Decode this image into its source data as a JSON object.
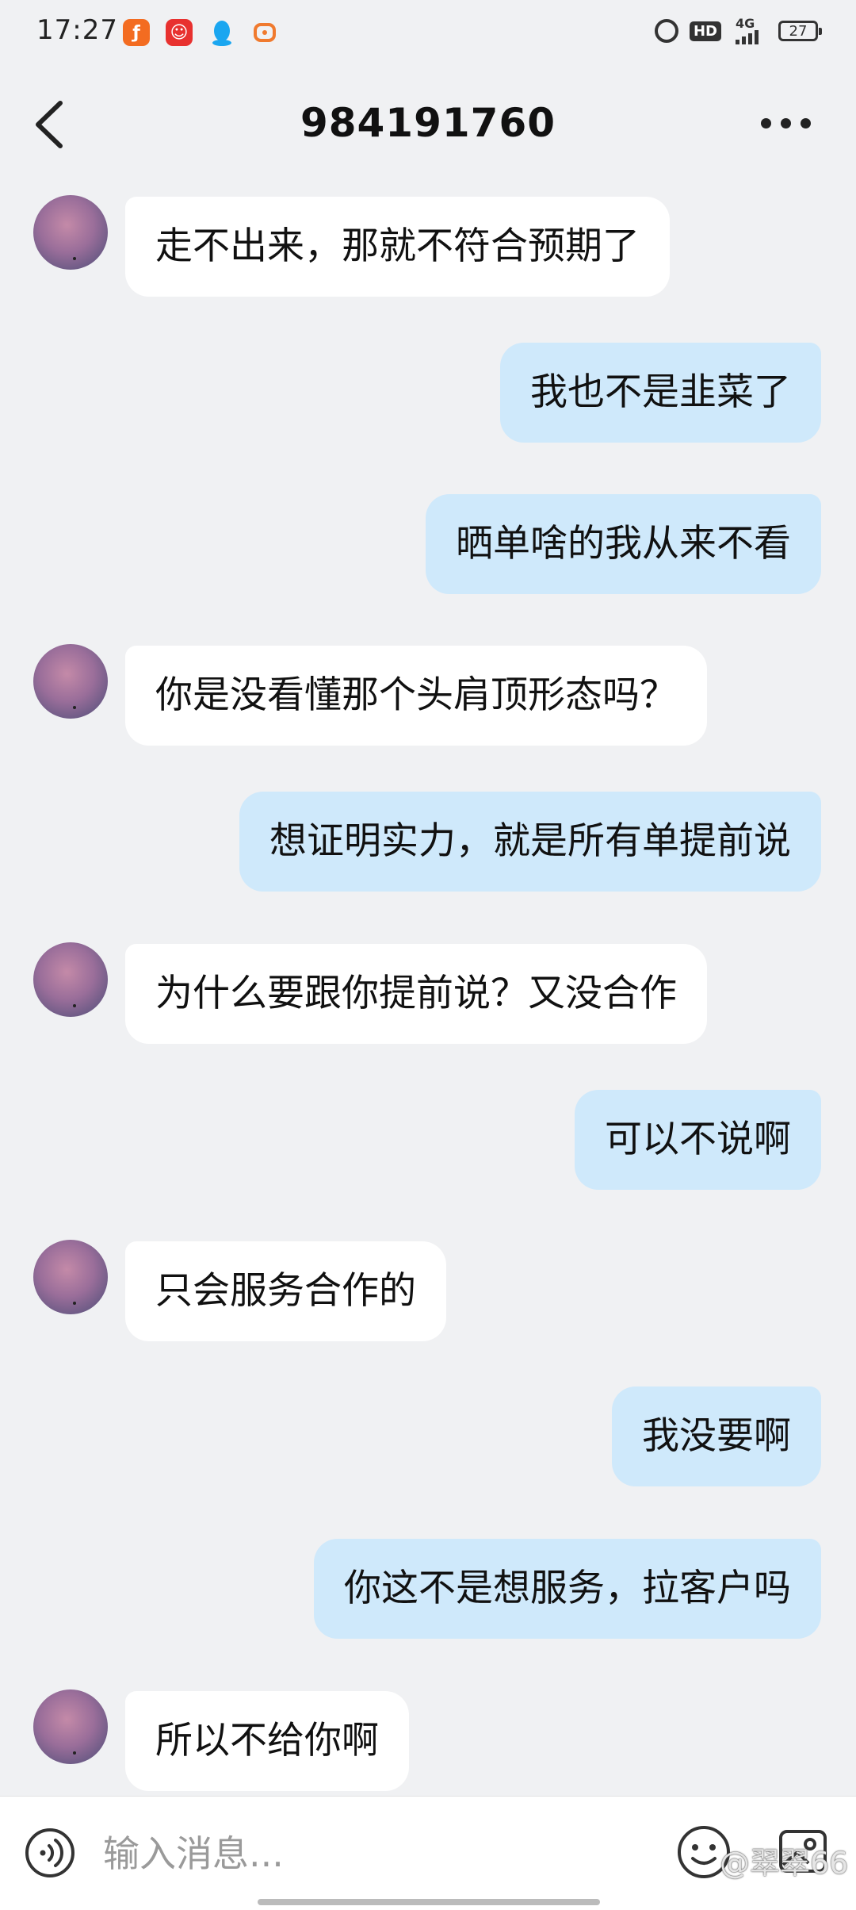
{
  "status_bar": {
    "time": "17:27",
    "network": "4G",
    "hd": "HD",
    "battery": "27",
    "notification_icons": [
      "fire-app-icon",
      "red-app-icon",
      "qq-penguin-icon",
      "orange-app-icon"
    ]
  },
  "header": {
    "title": "984191760",
    "back_icon": "chevron-left-icon",
    "more_icon": "more-dots-icon"
  },
  "messages": [
    {
      "side": "in",
      "text": "走不出来，那就不符合预期了"
    },
    {
      "side": "out",
      "text": "我也不是韭菜了"
    },
    {
      "side": "out",
      "text": "晒单啥的我从来不看"
    },
    {
      "side": "in",
      "text": "你是没看懂那个头肩顶形态吗？"
    },
    {
      "side": "out",
      "text": "想证明实力，就是所有单提前说"
    },
    {
      "side": "in",
      "text": "为什么要跟你提前说？又没合作"
    },
    {
      "side": "out",
      "text": "可以不说啊"
    },
    {
      "side": "in",
      "text": "只会服务合作的"
    },
    {
      "side": "out",
      "text": "我没要啊"
    },
    {
      "side": "out",
      "text": "你这不是想服务，拉客户吗"
    },
    {
      "side": "in",
      "text": "所以不给你啊"
    }
  ],
  "input_bar": {
    "placeholder": "输入消息...",
    "voice_icon": "voice-icon",
    "emoji_icon": "emoji-icon",
    "media_icon": "image-icon"
  },
  "watermark": "@翠翠66",
  "colors": {
    "background": "#f0f1f3",
    "incoming_bubble": "#ffffff",
    "outgoing_bubble": "#cfe9fb"
  }
}
